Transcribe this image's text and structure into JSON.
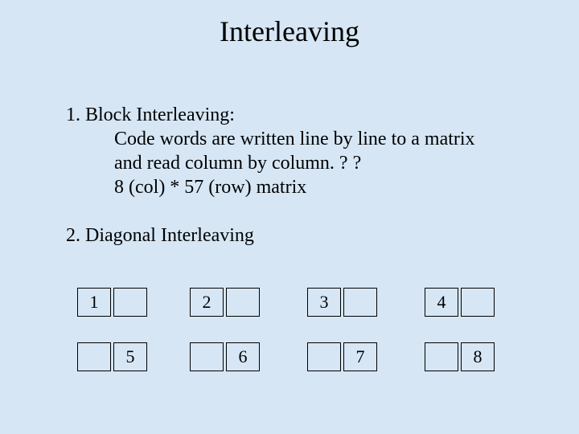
{
  "slide": {
    "title": "Interleaving",
    "section1": {
      "heading": "1. Block Interleaving:",
      "line1": "Code words are written line by line to a matrix",
      "line2": "and read column by column. ? ?",
      "line3": "8 (col) * 57 (row)  matrix"
    },
    "section2": {
      "heading": "2. Diagonal Interleaving"
    },
    "diagram": {
      "row1": {
        "c1": "1",
        "c2": "2",
        "c3": "3",
        "c4": "4"
      },
      "row2": {
        "c1": "5",
        "c2": "6",
        "c3": "7",
        "c4": "8"
      }
    }
  }
}
